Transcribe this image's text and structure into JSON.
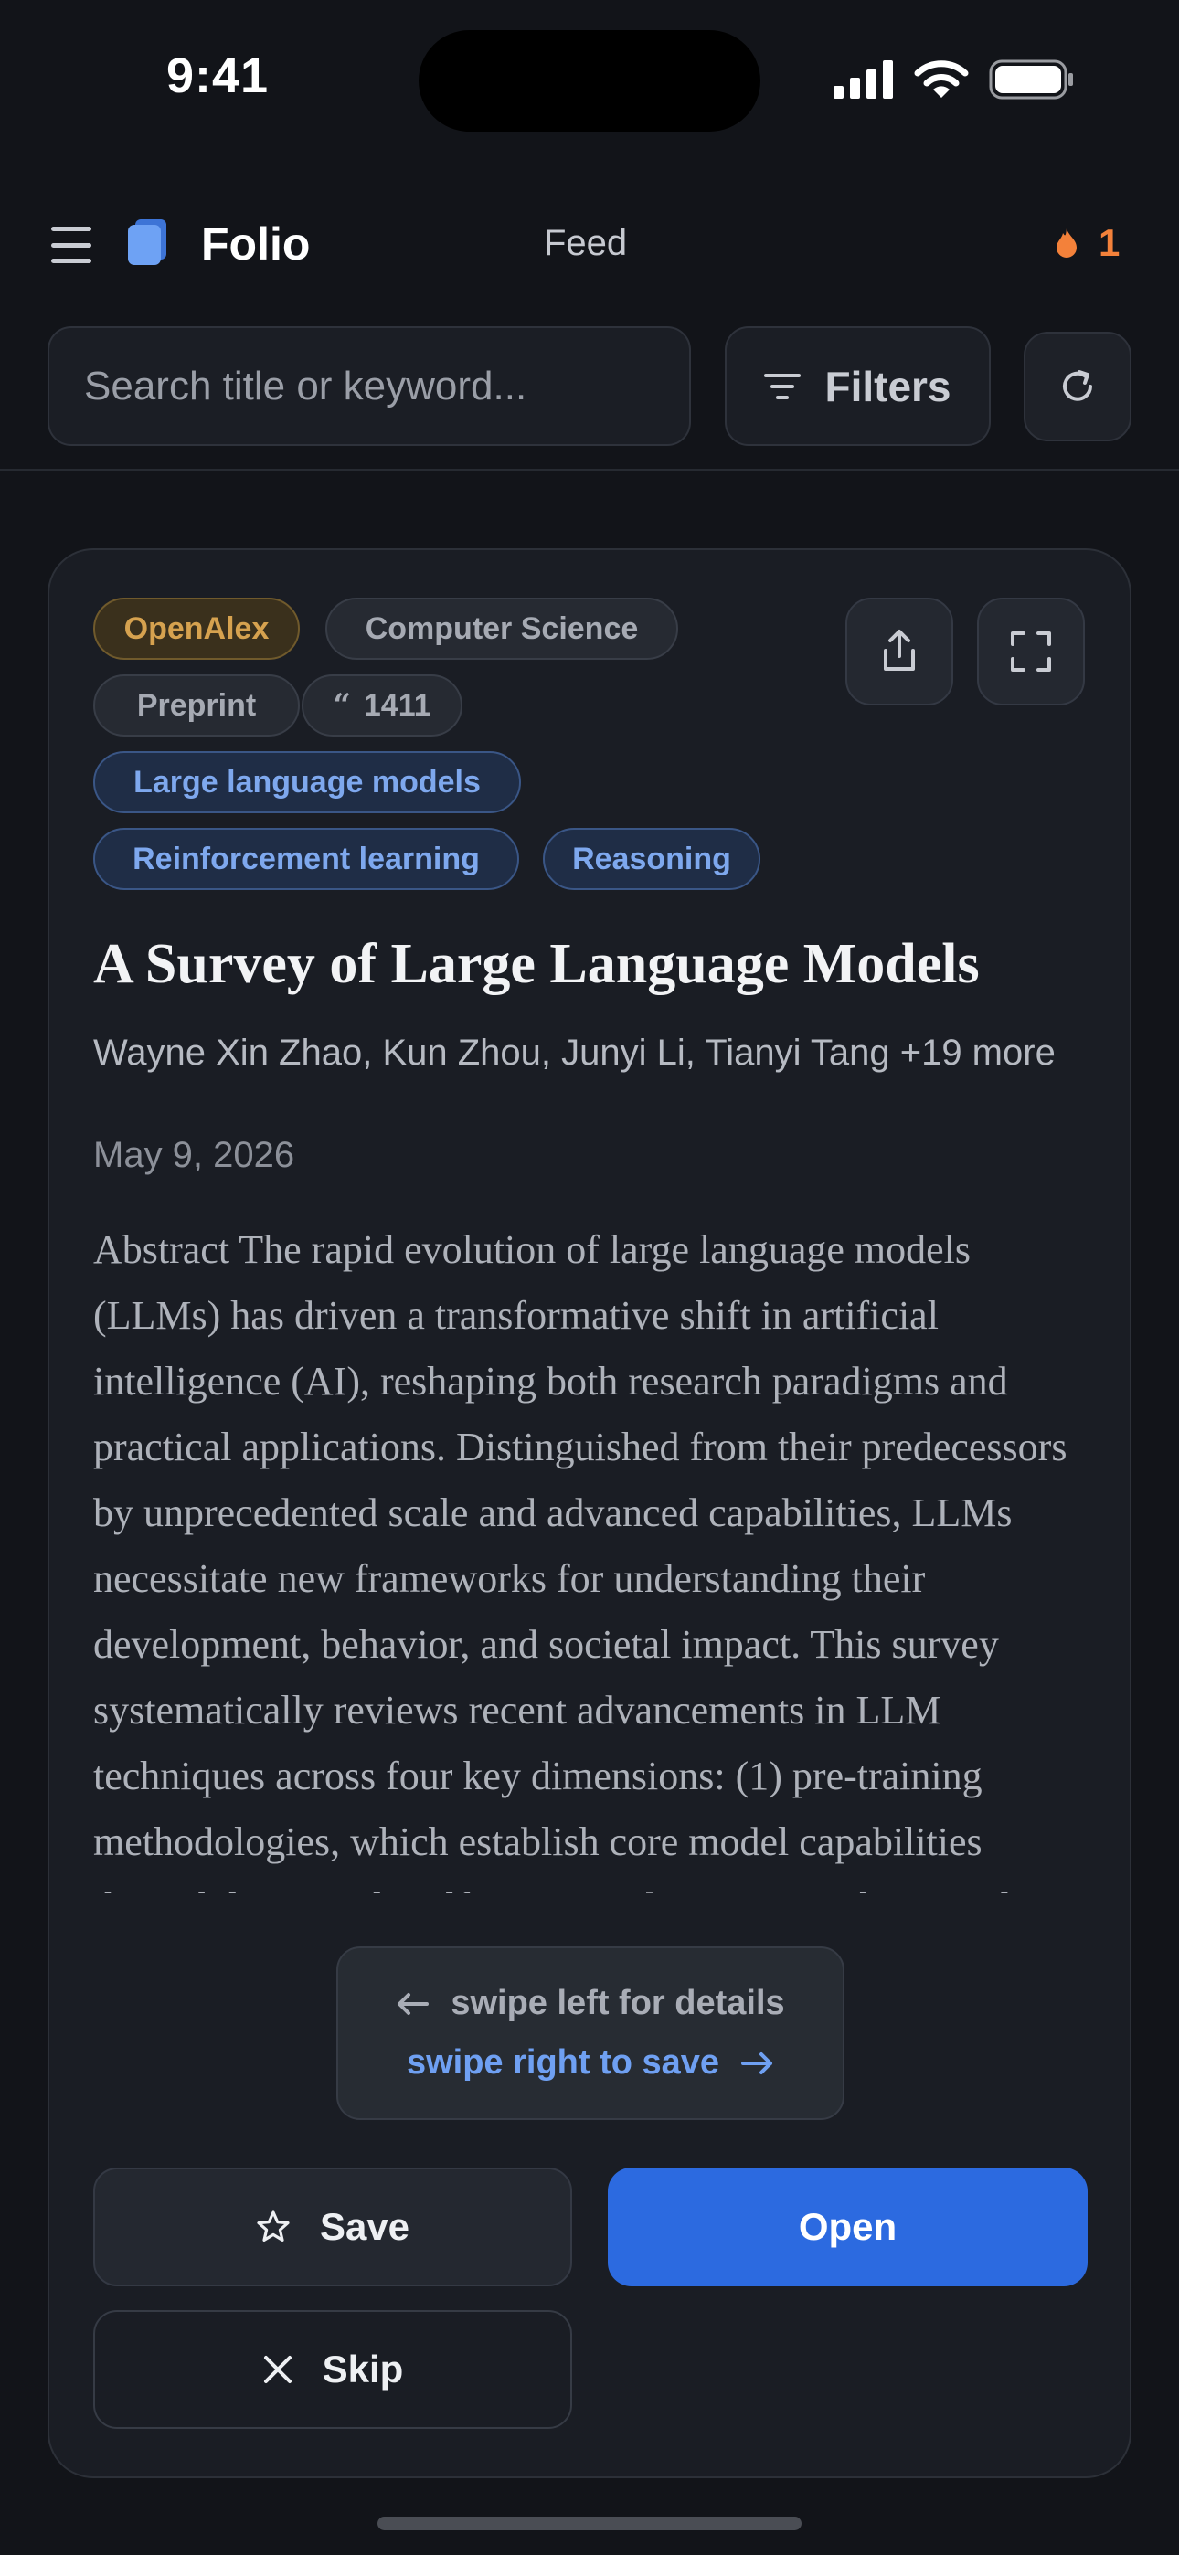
{
  "status_bar": {
    "time": "9:41"
  },
  "header": {
    "app_title": "Folio",
    "nav_label": "Feed",
    "streak_count": "1"
  },
  "search": {
    "placeholder": "Search title or keyword...",
    "value": ""
  },
  "toolbar": {
    "filters_label": "Filters"
  },
  "paper": {
    "chips": {
      "source": "OpenAlex",
      "field": "Computer Science",
      "type": "Preprint",
      "citations": "1411"
    },
    "topics": [
      "Large language models",
      "Reinforcement learning",
      "Reasoning"
    ],
    "title": "A Survey of Large Language Models",
    "authors": "Wayne Xin Zhao, Kun Zhou, Junyi Li, Tianyi Tang +19 more",
    "date": "May 9, 2026",
    "abstract": "Abstract The rapid evolution of large language models (LLMs) has driven a transformative shift in artificial intelligence (AI), reshaping both research paradigms and practical applications. Distinguished from their predecessors by unprecedented scale and advanced capabilities, LLMs necessitate new frameworks for understanding their development, behavior, and societal impact. This survey systematically reviews recent advancements in LLM techniques across four key dimensions: (1) pre-training methodologies, which establish core model capabilities through large-scale self-supervised training, architectural innovations, and data"
  },
  "hint": {
    "left": "swipe left for details",
    "right": "swipe right to save"
  },
  "actions": {
    "save": "Save",
    "open": "Open",
    "skip": "Skip"
  },
  "colors": {
    "accent": "#2c6ae0",
    "streak": "#f3813a",
    "source_chip": "#d6a24f",
    "topic_chip": "#7ea8ee"
  }
}
